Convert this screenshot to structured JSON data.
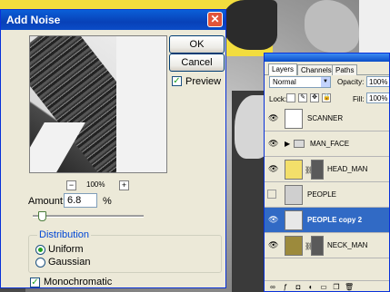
{
  "dialog": {
    "title": "Add Noise",
    "ok_label": "OK",
    "cancel_label": "Cancel",
    "preview_label": "Preview",
    "preview_checked": true,
    "zoom_level": "100%",
    "zoom_minus": "−",
    "zoom_plus": "+",
    "amount_label": "Amount:",
    "amount_value": "6.8",
    "amount_unit": "%",
    "distribution_label": "Distribution",
    "distribution_options": [
      "Uniform",
      "Gaussian"
    ],
    "distribution_selected": "Uniform",
    "monochromatic_label": "Monochromatic",
    "monochromatic_checked": true
  },
  "layers_panel": {
    "tabs": [
      "Layers",
      "Channels",
      "Paths"
    ],
    "active_tab": "Layers",
    "blend_mode": "Normal",
    "opacity_label": "Opacity:",
    "opacity_value": "100%",
    "lock_label": "Lock:",
    "fill_label": "Fill:",
    "fill_value": "100%",
    "layers": [
      {
        "name": "SCANNER",
        "visible": true,
        "type": "layer",
        "thumb_color": "#ffffff"
      },
      {
        "name": "MAN_FACE",
        "visible": true,
        "type": "group"
      },
      {
        "name": "HEAD_MAN",
        "visible": true,
        "type": "layer-mask",
        "thumb_color": "#f3df6a"
      },
      {
        "name": "PEOPLE",
        "visible": false,
        "type": "layer",
        "thumb_color": "#cfcfcf"
      },
      {
        "name": "PEOPLE copy 2",
        "visible": true,
        "type": "layer",
        "selected": true,
        "thumb_color": "#e8e8e8"
      },
      {
        "name": "NECK_MAN",
        "visible": true,
        "type": "layer-mask",
        "thumb_color": "#9c8a3c"
      }
    ]
  },
  "colors": {
    "titlebar": "#0a4cc8",
    "dialog_bg": "#ece9d8",
    "selection": "#316ac5",
    "accent_yellow": "#f2dd3e"
  }
}
